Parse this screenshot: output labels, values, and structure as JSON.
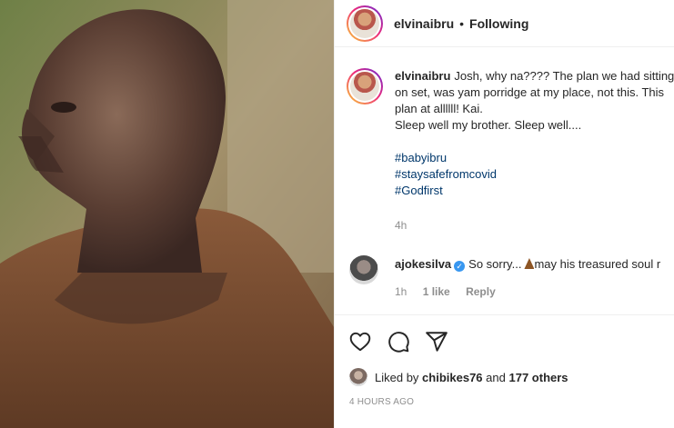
{
  "post": {
    "username": "elvinaibru",
    "separator": "•",
    "follow_status": "Following"
  },
  "caption": {
    "username": "elvinaibru",
    "line1": "Josh, why na???? The plan we had sitting",
    "line2": "on set, was yam porridge at my place, not this. This",
    "line3": "plan at allllll! Kai.",
    "line4": "Sleep well my brother. Sleep well....",
    "hashtags": [
      "#babyibru",
      "#staysafefromcovid",
      "#Godfirst"
    ],
    "time": "4h"
  },
  "comment": {
    "username": "ajokesilva",
    "verified_mark": "✓",
    "text_before": "So sorry...",
    "text_after": "may his treasured soul r",
    "time": "1h",
    "likes": "1 like",
    "reply": "Reply"
  },
  "actions": {
    "icons": [
      "heart-icon",
      "comment-icon",
      "share-icon"
    ]
  },
  "likes": {
    "prefix": "Liked by",
    "user": "chibikes76",
    "middle": "and",
    "others": "177 others"
  },
  "date": "4 HOURS AGO"
}
